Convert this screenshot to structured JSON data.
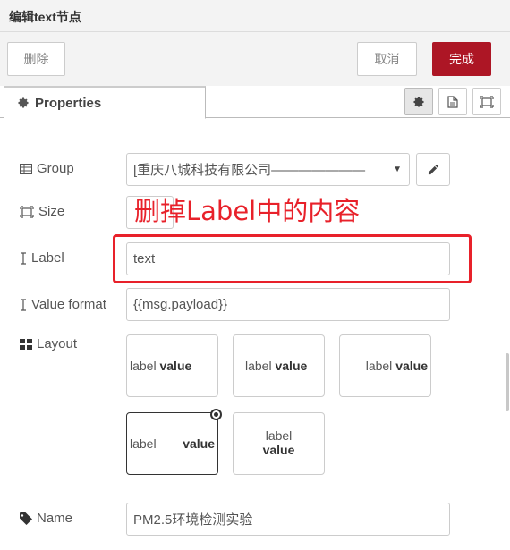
{
  "dialog": {
    "title": "编辑text节点"
  },
  "toolbar": {
    "delete_label": "删除",
    "cancel_label": "取消",
    "done_label": "完成"
  },
  "tabs": {
    "active_label": "Properties",
    "icon_buttons": [
      "gear-icon",
      "description-icon",
      "appearance-icon"
    ]
  },
  "form": {
    "group": {
      "label": "Group",
      "value": "[重庆八城科技有限公司———————"
    },
    "size": {
      "label": "Size"
    },
    "label_field": {
      "label": "Label",
      "value": "text"
    },
    "value_format": {
      "label": "Value format",
      "value": "{{msg.payload}}"
    },
    "layout": {
      "label": "Layout",
      "options": [
        {
          "label": "label",
          "value": "value"
        },
        {
          "label": "label",
          "value": "value"
        },
        {
          "label": "label",
          "value": "value"
        },
        {
          "label": "label",
          "value": "value"
        },
        {
          "label": "label",
          "value": "value"
        }
      ],
      "selected_index": 3
    },
    "name": {
      "label": "Name",
      "value": "PM2.5环境检测实验"
    }
  },
  "annotation": {
    "text": "删掉Label中的内容"
  },
  "colors": {
    "primary": "#ad1625",
    "annotation": "#e8212a"
  }
}
